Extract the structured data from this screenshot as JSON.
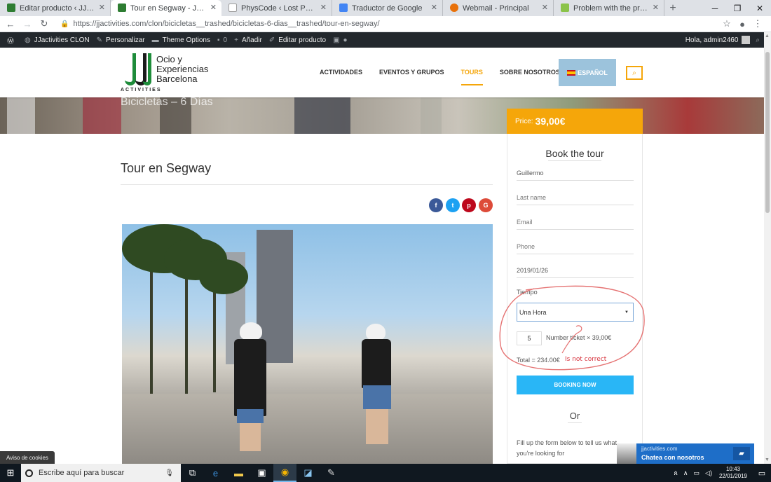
{
  "browser": {
    "tabs": [
      {
        "label": "Editar producto ‹ JJactivities CLO",
        "favicon_color": "#2e7d32"
      },
      {
        "label": "Tour en Segway - JJactivities CLO",
        "favicon_color": "#2e7d32"
      },
      {
        "label": "PhysCode ‹ Lost Password",
        "favicon_color": "#9e9e9e"
      },
      {
        "label": "Traductor de Google",
        "favicon_color": "#4285f4"
      },
      {
        "label": "Webmail - Principal",
        "favicon_color": "#e8710a"
      },
      {
        "label": "Problem with the price variation",
        "favicon_color": "#8bc34a"
      }
    ],
    "active_tab": 1,
    "url": "https://jjactivities.com/clon/bicicletas__trashed/bicicletas-6-dias__trashed/tour-en-segway/"
  },
  "adminbar": {
    "site_name": "JJactivities CLON",
    "customize": "Personalizar",
    "theme_options": "Theme Options",
    "comments_count": "0",
    "add_new": "Añadir",
    "edit_product": "Editar producto",
    "greeting": "Hola, admin2460"
  },
  "header": {
    "logo_line1": "Ocio y",
    "logo_line2": "Experiencias",
    "logo_line3": "Barcelona",
    "logo_tagline": "ACTIVITIES",
    "nav": [
      "ACTIVIDADES",
      "EVENTOS Y GRUPOS",
      "TOURS",
      "SOBRE NOSOTROS"
    ],
    "active_nav": "TOURS",
    "language": "ESPAÑOL",
    "accent_color": "#f5a60a"
  },
  "banner": {
    "title": "Bicicletas – 6 Días",
    "price_label": "Price:",
    "price_value": "39,00€"
  },
  "product": {
    "title": "Tour en Segway",
    "share": [
      {
        "icon": "facebook-icon",
        "glyph": "f",
        "color": "#3b5998"
      },
      {
        "icon": "twitter-icon",
        "glyph": "t",
        "color": "#1da1f2"
      },
      {
        "icon": "pinterest-icon",
        "glyph": "p",
        "color": "#bd081c"
      },
      {
        "icon": "google-plus-icon",
        "glyph": "G",
        "color": "#dd4b39"
      }
    ]
  },
  "booking": {
    "title": "Book the tour",
    "first_name": "Guillermo",
    "last_name_placeholder": "Last name",
    "email_placeholder": "Email",
    "phone_placeholder": "Phone",
    "date": "2019/01/26",
    "tiempo_label": "Tiempo",
    "tiempo_value": "Una Hora",
    "quantity": "5",
    "ticket_label": "Number ticket  × 39,00€",
    "total": "Total = 234.00€",
    "book_button": "BOOKING NOW",
    "or_label": "Or",
    "fill_text": "Fill up the form below to tell us what you're looking for",
    "button_color": "#29b6f6"
  },
  "annotation": {
    "note": "Is not correct",
    "color": "#d62f3a"
  },
  "chat": {
    "domain": "jjactivities.com",
    "label": "Chatea con nosotros"
  },
  "cookie_notice": "Aviso de cookies",
  "taskbar": {
    "search_placeholder": "Escribe aquí para buscar",
    "time": "10:43",
    "date": "22/01/2019"
  }
}
